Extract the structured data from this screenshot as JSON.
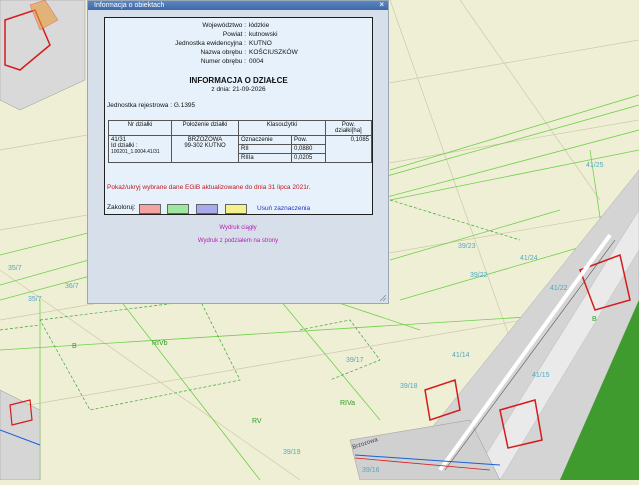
{
  "dialog": {
    "title": "Informacja o obiektach",
    "close_glyph": "×",
    "header_rows": [
      {
        "key": "Województwo :",
        "value": "łódzkie"
      },
      {
        "key": "Powiat :",
        "value": "kutnowski"
      },
      {
        "key": "Jednostka ewidencyjna :",
        "value": "KUTNO"
      },
      {
        "key": "Nazwa obrębu :",
        "value": "KOŚCIUSZKÓW"
      },
      {
        "key": "Numer obrębu :",
        "value": "0004"
      }
    ],
    "heading": "INFORMACJA O DZIAŁCE",
    "date_line": "z dnia: 21-09-2026",
    "registry_unit": "Jednostka rejestrowa : G.1395",
    "table": {
      "headers": [
        "Nr działki",
        "Położenie działki",
        "Klasoużytki",
        "Pow. działki[ha]"
      ],
      "parcel_number": "41/31",
      "parcel_id_label": "Id działki :",
      "parcel_id": "100201_1.0004.41/31",
      "location_line1": "BRZOZOWA",
      "location_line2": "99-302 KUTNO",
      "class_headers": [
        "Oznaczenie",
        "Pow."
      ],
      "class_rows": [
        {
          "symbol": "RII",
          "area": "0,0880"
        },
        {
          "symbol": "RIIIa",
          "area": "0,0205"
        }
      ],
      "total_area": "0,1085"
    },
    "notice": "Pokaż/ukryj wybrane dane EGiB aktualizowane do dnia 31 lipca 2021r.",
    "coloring_label": "Zakoloruj:",
    "swatches": [
      "#f4a3a3",
      "#9ee89e",
      "#a9a9ee",
      "#f4f08a"
    ],
    "clear_link": "Usuń zaznaczenia",
    "print_continuous": "Wydruk ciągły",
    "print_paged": "Wydruk z podziałem na strony"
  },
  "map": {
    "parcel_labels": [
      "41/25",
      "39/23",
      "39/22",
      "41/24",
      "41/22",
      "41/14",
      "41/15",
      "39/17",
      "39/18",
      "39/19",
      "39/16",
      "35/7",
      "36/7",
      "35/7"
    ],
    "landuse_labels": [
      "RIVb",
      "RIVa",
      "RV",
      "B",
      "B"
    ],
    "street_name": "Brzozowa",
    "colors": {
      "background": "#efefd6",
      "parcel_line": "#6fcf4a",
      "contour_line": "#cfc8a8",
      "building": "#d61b1b",
      "road": "#c9c9c9",
      "green": "#3a9a2e"
    }
  }
}
